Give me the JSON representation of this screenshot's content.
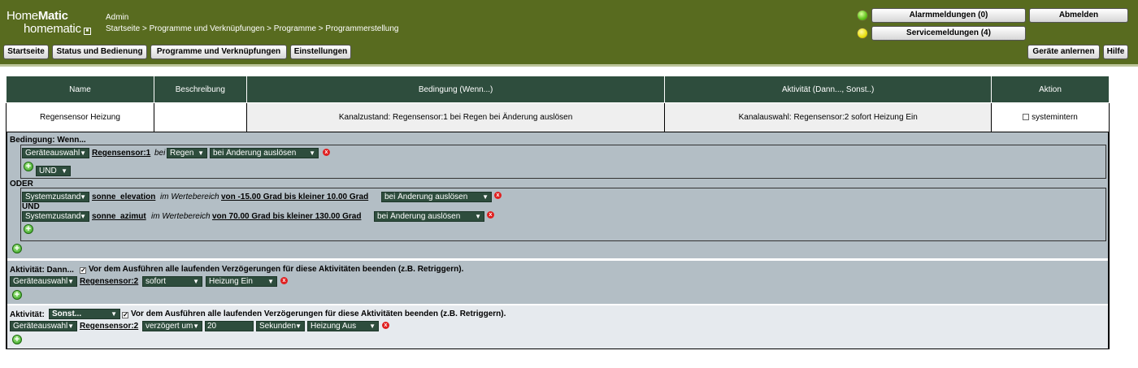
{
  "header": {
    "logo_line1_a": "Home",
    "logo_line1_b": "Matic",
    "logo_line2": "homematic",
    "user": "Admin",
    "breadcrumb": "Startseite > Programme und Verknüpfungen > Programme > Programmerstellung",
    "alarm_label": "Alarmmeldungen (0)",
    "logout_label": "Abmelden",
    "service_label": "Servicemeldungen (4)",
    "status_colors": {
      "alarm": "#5fc21a",
      "service": "#e8e010"
    }
  },
  "toolbar": {
    "start": "Startseite",
    "status": "Status und Bedienung",
    "programs": "Programme und Verknüpfungen",
    "settings": "Einstellungen",
    "learn": "Geräte anlernen",
    "help": "Hilfe"
  },
  "program_table": {
    "headers": [
      "Name",
      "Beschreibung",
      "Bedingung (Wenn...)",
      "Aktivität (Dann..., Sonst..)",
      "Aktion"
    ],
    "row": {
      "name": "Regensensor Heizung",
      "description": "",
      "condition": "Kanalzustand: Regensensor:1 bei Regen bei Änderung auslösen",
      "activity": "Kanalauswahl: Regensensor:2 sofort Heizung Ein",
      "action_label": "systemintern"
    }
  },
  "condition": {
    "title": "Bedingung: Wenn...",
    "block1": {
      "select_type": "Geräteauswahl",
      "device": "Regensensor:1",
      "word": "bei",
      "select_value": "Regen",
      "select_trigger": "bei Änderung auslösen",
      "select_op": "UND"
    },
    "or_label": "ODER",
    "block2": {
      "line1": {
        "select_type": "Systemzustand",
        "var": "sonne_elevation",
        "word": "im Wertebereich",
        "range": "von -15.00 Grad bis kleiner 10.00 Grad",
        "select_trigger": "bei Änderung auslösen"
      },
      "and_label": "UND",
      "line2": {
        "select_type": "Systemzustand",
        "var": "sonne_azimut",
        "word": "im Wertebereich",
        "range": "von 70.00 Grad bis kleiner 130.00 Grad",
        "select_trigger": "bei Änderung auslösen"
      }
    }
  },
  "then_activity": {
    "title": "Aktivität: Dann...",
    "retrigger_label": "Vor dem Ausführen alle laufenden Verzögerungen für diese Aktivitäten beenden (z.B. Retriggern).",
    "select_type": "Geräteauswahl",
    "device": "Regensensor:2",
    "select_timing": "sofort",
    "select_action": "Heizung Ein"
  },
  "else_activity": {
    "title": "Aktivität:",
    "select_else": "Sonst...",
    "retrigger_label": "Vor dem Ausführen alle laufenden Verzögerungen für diese Aktivitäten beenden (z.B. Retriggern).",
    "select_type": "Geräteauswahl",
    "device": "Regensensor:2",
    "select_timing": "verzögert um",
    "delay_value": "20",
    "select_unit": "Sekunden",
    "select_action": "Heizung Aus"
  }
}
